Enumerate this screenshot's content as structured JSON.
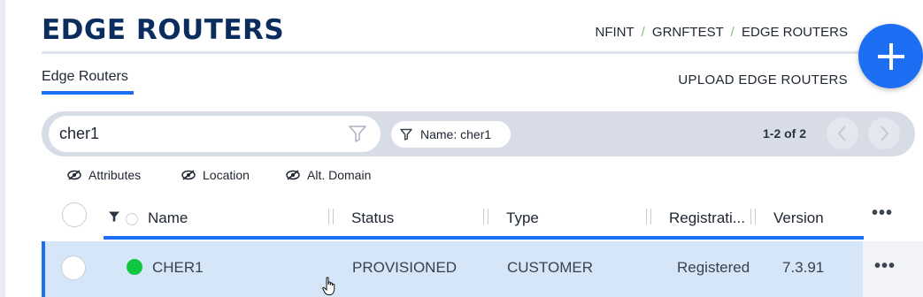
{
  "page": {
    "title": "EDGE ROUTERS",
    "breadcrumb": [
      "NFINT",
      "GRNFTEST",
      "EDGE ROUTERS"
    ],
    "breadcrumb_separator": "/"
  },
  "tabs": [
    {
      "label": "Edge Routers",
      "active": true
    }
  ],
  "actions": {
    "upload_label": "UPLOAD EDGE ROUTERS",
    "add_icon": "plus-icon"
  },
  "search": {
    "value": "cher1",
    "placeholder": ""
  },
  "filters": [
    {
      "label": "Name: cher1"
    }
  ],
  "pagination": {
    "label": "1-2 of 2"
  },
  "column_toggles": [
    {
      "label": "Attributes",
      "icon": "eye-slash-icon"
    },
    {
      "label": "Location",
      "icon": "eye-slash-icon"
    },
    {
      "label": "Alt. Domain",
      "icon": "eye-slash-icon"
    }
  ],
  "table": {
    "columns": [
      "Name",
      "Status",
      "Type",
      "Registrati...",
      "Version"
    ],
    "rows": [
      {
        "name": "CHER1",
        "online": true,
        "status": "PROVISIONED",
        "type": "CUSTOMER",
        "registration": "Registered",
        "version": "7.3.91"
      }
    ],
    "row_actions_label": "•••"
  },
  "colors": {
    "brand_dark": "#0b2d5e",
    "accent": "#1c6ef2",
    "online": "#11c741",
    "selected_row": "#d5e6f8"
  }
}
